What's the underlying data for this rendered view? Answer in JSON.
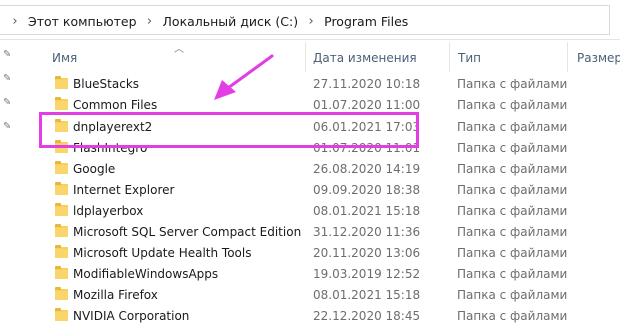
{
  "breadcrumb": {
    "items": [
      "Этот компьютер",
      "Локальный диск (C:)",
      "Program Files"
    ],
    "separator": "›"
  },
  "columns": {
    "name": "Имя",
    "date": "Дата изменения",
    "type": "Тип",
    "size": "Размер"
  },
  "rows": [
    {
      "name": "BlueStacks",
      "date": "27.11.2020 10:18",
      "type": "Папка с файлами"
    },
    {
      "name": "Common Files",
      "date": "01.07.2020 11:00",
      "type": "Папка с файлами"
    },
    {
      "name": "dnplayerext2",
      "date": "06.01.2021 17:03",
      "type": "Папка с файлами"
    },
    {
      "name": "FlashIntegro",
      "date": "01.07.2020 11:01",
      "type": "Папка с файлами"
    },
    {
      "name": "Google",
      "date": "26.08.2020 14:19",
      "type": "Папка с файлами"
    },
    {
      "name": "Internet Explorer",
      "date": "09.09.2020 18:38",
      "type": "Папка с файлами"
    },
    {
      "name": "ldplayerbox",
      "date": "08.01.2021 15:18",
      "type": "Папка с файлами"
    },
    {
      "name": "Microsoft SQL Server Compact Edition",
      "date": "31.12.2020 11:36",
      "type": "Папка с файлами"
    },
    {
      "name": "Microsoft Update Health Tools",
      "date": "20.11.2020 13:06",
      "type": "Папка с файлами"
    },
    {
      "name": "ModifiableWindowsApps",
      "date": "19.03.2019 12:52",
      "type": "Папка с файлами"
    },
    {
      "name": "Mozilla Firefox",
      "date": "08.01.2021 15:18",
      "type": "Папка с файлами"
    },
    {
      "name": "NVIDIA Corporation",
      "date": "22.12.2020 18:45",
      "type": "Папка с файлами"
    }
  ],
  "annotation": {
    "highlight_color": "#e33ee3",
    "highlighted_row": "dnplayerext2"
  }
}
